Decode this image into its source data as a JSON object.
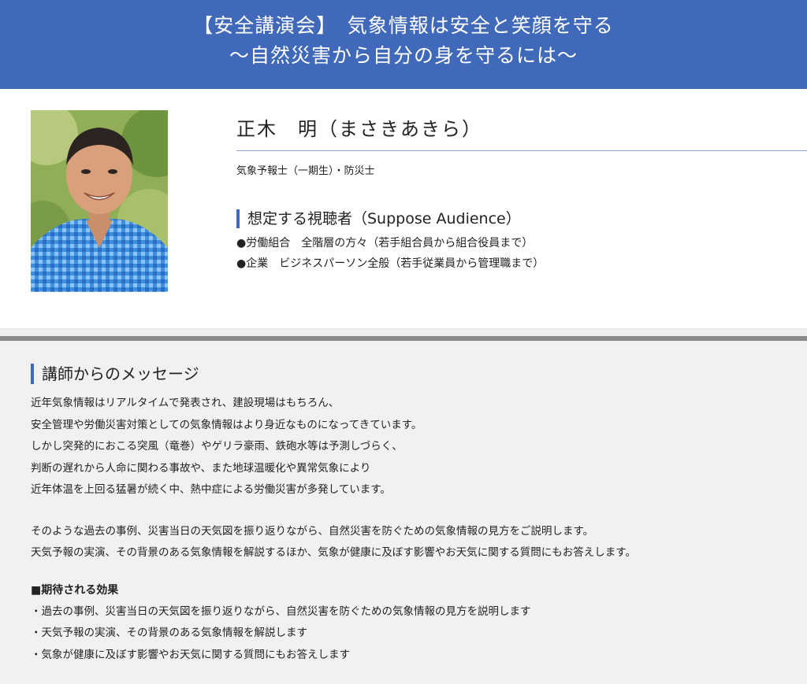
{
  "banner": {
    "line1": "【安全講演会】　気象情報は安全と笑顔を守る",
    "line2": "〜自然災害から自分の身を守るには〜"
  },
  "profile": {
    "name": "正木　明（まさきあきら）",
    "title": "気象予報士（一期生）・防災士",
    "audience_heading": "想定する視聴者（Suppose Audience）",
    "audience_items": [
      "●労働組合　全階層の方々（若手組合員から組合役員まで）",
      "●企業　ビジネスパーソン全般（若手従業員から管理職まで）"
    ]
  },
  "message": {
    "heading": "講師からのメッセージ",
    "paragraph1": [
      "近年気象情報はリアルタイムで発表され、建設現場はもちろん、",
      "安全管理や労働災害対策としての気象情報はより身近なものになってきています。",
      "しかし突発的におこる突風（竜巻）やゲリラ豪雨、鉄砲水等は予測しづらく、",
      "判断の遅れから人命に関わる事故や、また地球温暖化や異常気象により",
      "近年体温を上回る猛暑が続く中、熱中症による労働災害が多発しています。"
    ],
    "paragraph2": [
      "そのような過去の事例、災害当日の天気図を振り返りながら、自然災害を防ぐための気象情報の見方をご説明します。",
      "天気予報の実演、その背景のある気象情報を解説するほか、気象が健康に及ぼす影響やお天気に関する質問にもお答えします。"
    ],
    "effects_title": "■期待される効果",
    "effects": [
      "・過去の事例、災害当日の天気図を振り返りながら、自然災害を防ぐための気象情報の見方を説明します",
      "・天気予報の実演、その背景のある気象情報を解説します",
      "・気象が健康に及ぼす影響やお天気に関する質問にもお答えします"
    ]
  },
  "colors": {
    "banner": "#4169b9",
    "accent": "#4169b9",
    "message_bg": "#f1f1f1"
  }
}
